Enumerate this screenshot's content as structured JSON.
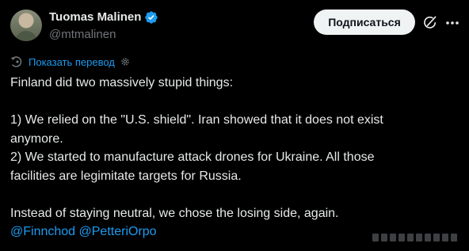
{
  "author": {
    "name": "Tuomas Malinen",
    "handle": "@mtmalinen",
    "verified": true
  },
  "actions": {
    "follow_label": "Подписаться"
  },
  "translate": {
    "label": "Показать перевод"
  },
  "tweet": {
    "line1": "Finland did two massively stupid things:",
    "line2": "1) We relied on the \"U.S. shield\". Iran showed that it does not exist",
    "line3": "anymore.",
    "line4": "2) We started to manufacture attack drones for Ukraine. All those",
    "line5": "facilities are legimitate targets for Russia.",
    "line6": "Instead of staying neutral, we chose the losing side, again.",
    "mention1": "@Finnchod",
    "mention2": "@PetteriOrpo"
  },
  "colors": {
    "background": "#000000",
    "text": "#e7e9ea",
    "muted": "#71767b",
    "link": "#1d9bf0",
    "verified": "#1d9bf0",
    "button_bg": "#eff3f4"
  },
  "icons": {
    "verified": "verified-badge-icon",
    "grok": "grok-icon",
    "more": "more-icon",
    "translate": "translate-icon",
    "settings": "gear-icon"
  }
}
